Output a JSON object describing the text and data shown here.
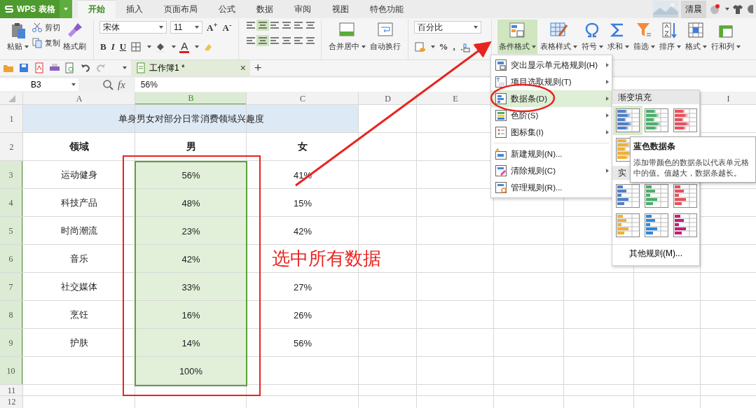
{
  "app_menu": {
    "label": "WPS 表格"
  },
  "tabs": [
    {
      "label": "开始",
      "selected": true
    },
    {
      "label": "插入",
      "selected": false
    },
    {
      "label": "页面布局",
      "selected": false
    },
    {
      "label": "公式",
      "selected": false
    },
    {
      "label": "数据",
      "selected": false
    },
    {
      "label": "审阅",
      "selected": false
    },
    {
      "label": "视图",
      "selected": false
    },
    {
      "label": "特色功能",
      "selected": false
    }
  ],
  "user": {
    "name": "清晨"
  },
  "ribbon": {
    "paste": "粘贴",
    "cut": "剪切",
    "copy": "复制",
    "format_painter": "格式刷",
    "font": "宋体",
    "font_size": "11",
    "font_grow": "A$^{+}$",
    "font_shrink": "A$^{-}$",
    "bold": "B",
    "italic": "I",
    "underline": "U",
    "font_color": "A",
    "merge": "合并居中",
    "wrap": "自动换行",
    "number_format": "百分比",
    "percent": "%",
    "comma": ",",
    "big_buttons": [
      {
        "label": "条件格式",
        "kind": "conditional",
        "selected": true
      },
      {
        "label": "表格样式",
        "kind": "table_style",
        "selected": false
      },
      {
        "label": "符号",
        "kind": "symbol",
        "selected": false
      },
      {
        "label": "求和",
        "kind": "sum",
        "selected": false
      },
      {
        "label": "筛选",
        "kind": "filter",
        "selected": false
      },
      {
        "label": "排序",
        "kind": "sort",
        "selected": false
      },
      {
        "label": "格式",
        "kind": "format",
        "selected": false
      },
      {
        "label": "行和列",
        "kind": "rows_cols",
        "selected": false
      }
    ]
  },
  "document_tab": {
    "title": "工作簿1 *",
    "close": "×",
    "new_tab": "+"
  },
  "formula_bar": {
    "name_box": "B3",
    "fx": "fx",
    "value": "56%"
  },
  "sheet": {
    "column_headers": [
      {
        "label": "A",
        "selected": false
      },
      {
        "label": "B",
        "selected": true
      },
      {
        "label": "C",
        "selected": false
      },
      {
        "label": "D",
        "selected": false
      },
      {
        "label": "E",
        "selected": false
      }
    ],
    "last_column_header": {
      "label": "I"
    },
    "row_headers": [
      {
        "label": "1",
        "selected": false
      },
      {
        "label": "2",
        "selected": false
      },
      {
        "label": "3",
        "selected": true
      },
      {
        "label": "4",
        "selected": true
      },
      {
        "label": "5",
        "selected": true
      },
      {
        "label": "6",
        "selected": true
      },
      {
        "label": "7",
        "selected": true
      },
      {
        "label": "8",
        "selected": true
      },
      {
        "label": "9",
        "selected": true
      },
      {
        "label": "10",
        "selected": true
      },
      {
        "label": "11",
        "selected": false
      },
      {
        "label": "12",
        "selected": false
      }
    ],
    "title": "单身男女对部分日常消费领域兴趣度",
    "header": {
      "field": "领域",
      "male": "男",
      "female": "女"
    },
    "rows": [
      {
        "field": "运动健身",
        "male": "56%",
        "female": "41%",
        "selected": true
      },
      {
        "field": "科技产品",
        "male": "48%",
        "female": "15%",
        "selected": true
      },
      {
        "field": "时尚潮流",
        "male": "23%",
        "female": "42%",
        "selected": true
      },
      {
        "field": "音乐",
        "male": "42%",
        "selected": true
      },
      {
        "field": "社交媒体",
        "male": "33%",
        "female": "27%",
        "selected": true
      },
      {
        "field": "烹饪",
        "male": "16%",
        "female": "26%",
        "selected": true
      },
      {
        "field": "护肤",
        "male": "14%",
        "female": "56%",
        "selected": true
      },
      {
        "male": "100%",
        "selected": true
      }
    ]
  },
  "menu": [
    {
      "label": "突出显示单元格规则(H)",
      "kind": "highlight",
      "submenu": true,
      "selected": false
    },
    {
      "label": "项目选取规则(T)",
      "kind": "top",
      "submenu": true,
      "selected": false
    },
    {
      "label": "数据条(D)",
      "kind": "databar",
      "submenu": true,
      "selected": true
    },
    {
      "label": "色阶(S)",
      "kind": "scale",
      "submenu": true,
      "selected": false
    },
    {
      "label": "图标集(I)",
      "kind": "iconset",
      "submenu": true,
      "selected": false,
      "separator_after": true
    },
    {
      "label": "新建规则(N)...",
      "kind": "new",
      "submenu": false,
      "selected": false
    },
    {
      "label": "清除规则(C)",
      "kind": "clear",
      "submenu": true,
      "selected": false
    },
    {
      "label": "管理规则(R)...",
      "kind": "manage",
      "submenu": false,
      "selected": false
    }
  ],
  "submenu": {
    "gradient_header": "渐变填充",
    "gradient_swatches": [
      {
        "color": "#4f7fc8",
        "selected": true
      },
      {
        "color": "#4caf6a",
        "selected": false
      },
      {
        "color": "#e8505b",
        "selected": false
      },
      {
        "color": "#f0b030",
        "selected": false
      }
    ],
    "solid_header": "实",
    "solid_swatches": [
      {
        "color": "#4f7fc8",
        "selected": false
      },
      {
        "color": "#4caf6a",
        "selected": false
      },
      {
        "color": "#e8505b",
        "selected": false
      },
      {
        "color": "#f0b030",
        "selected": false
      },
      {
        "color": "#2a8ae0",
        "selected": false
      },
      {
        "color": "#c8197a",
        "selected": false
      }
    ],
    "more": "其他规则(M)..."
  },
  "tooltip": {
    "title": "蓝色数据条",
    "body": "添加带颜色的数据条以代表单元格中的值。值越大，数据条越长。"
  },
  "annotation": {
    "text": "选中所有数据"
  }
}
